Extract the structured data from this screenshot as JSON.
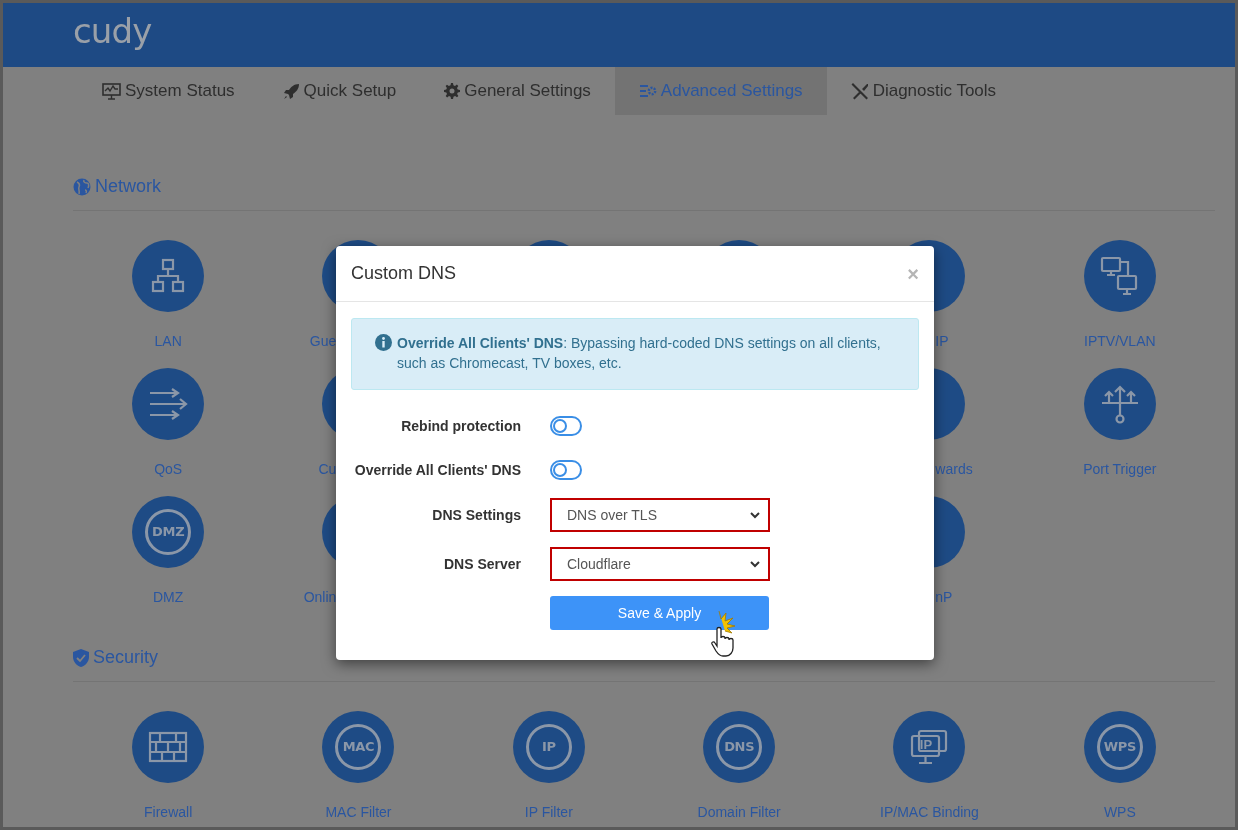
{
  "header": {
    "logo": "cudy"
  },
  "tabs": [
    {
      "label": "System Status",
      "selected": false
    },
    {
      "label": "Quick Setup",
      "selected": false
    },
    {
      "label": "General Settings",
      "selected": false
    },
    {
      "label": "Advanced Settings",
      "selected": true
    },
    {
      "label": "Diagnostic Tools",
      "selected": false
    }
  ],
  "sections": [
    {
      "title": "Network",
      "tiles": [
        {
          "kind": "tile",
          "label": "LAN"
        },
        {
          "kind": "cut_end",
          "label": "Gue"
        },
        {
          "kind": "covered"
        },
        {
          "kind": "covered"
        },
        {
          "kind": "cut_start",
          "label": "IP"
        },
        {
          "kind": "tile",
          "label": "IPTV/VLAN"
        },
        {
          "kind": "tile",
          "label": "QoS"
        },
        {
          "kind": "cut_end",
          "label": "Cu"
        },
        {
          "kind": "hidden"
        },
        {
          "kind": "hidden"
        },
        {
          "kind": "cut_start",
          "label": "wards"
        },
        {
          "kind": "tile",
          "label": "Port Trigger"
        },
        {
          "kind": "tile",
          "label": "DMZ",
          "badge": "DMZ"
        },
        {
          "kind": "cut_end",
          "label": "Onlin"
        },
        {
          "kind": "hidden"
        },
        {
          "kind": "hidden"
        },
        {
          "kind": "cut_start",
          "label": "nP"
        }
      ]
    },
    {
      "title": "Security",
      "tiles": [
        {
          "kind": "tile",
          "label": "Firewall"
        },
        {
          "kind": "tile",
          "label": "MAC Filter",
          "badge": "MAC"
        },
        {
          "kind": "tile",
          "label": "IP Filter",
          "badge": "IP"
        },
        {
          "kind": "tile",
          "label": "Domain Filter",
          "badge": "DNS"
        },
        {
          "kind": "tile",
          "label": "IP/MAC Binding",
          "badge": "IP"
        },
        {
          "kind": "tile",
          "label": "WPS",
          "badge": "WPS"
        }
      ]
    }
  ],
  "dialog": {
    "title": "Custom DNS",
    "close": "×",
    "info": "**Override All Clients' DNS**: Bypassing hard-coded DNS settings on all clients, such as Chromecast, TV boxes, etc.",
    "fields": [
      {
        "kind": "toggle",
        "label": "Rebind protection",
        "on": false
      },
      {
        "kind": "toggle",
        "label": "Override All Clients' DNS",
        "on": false
      },
      {
        "kind": "select",
        "label": "DNS Settings",
        "value": "DNS over TLS"
      },
      {
        "kind": "select",
        "label": "DNS Server",
        "value": "Cloudflare"
      }
    ],
    "button": "Save & Apply"
  }
}
